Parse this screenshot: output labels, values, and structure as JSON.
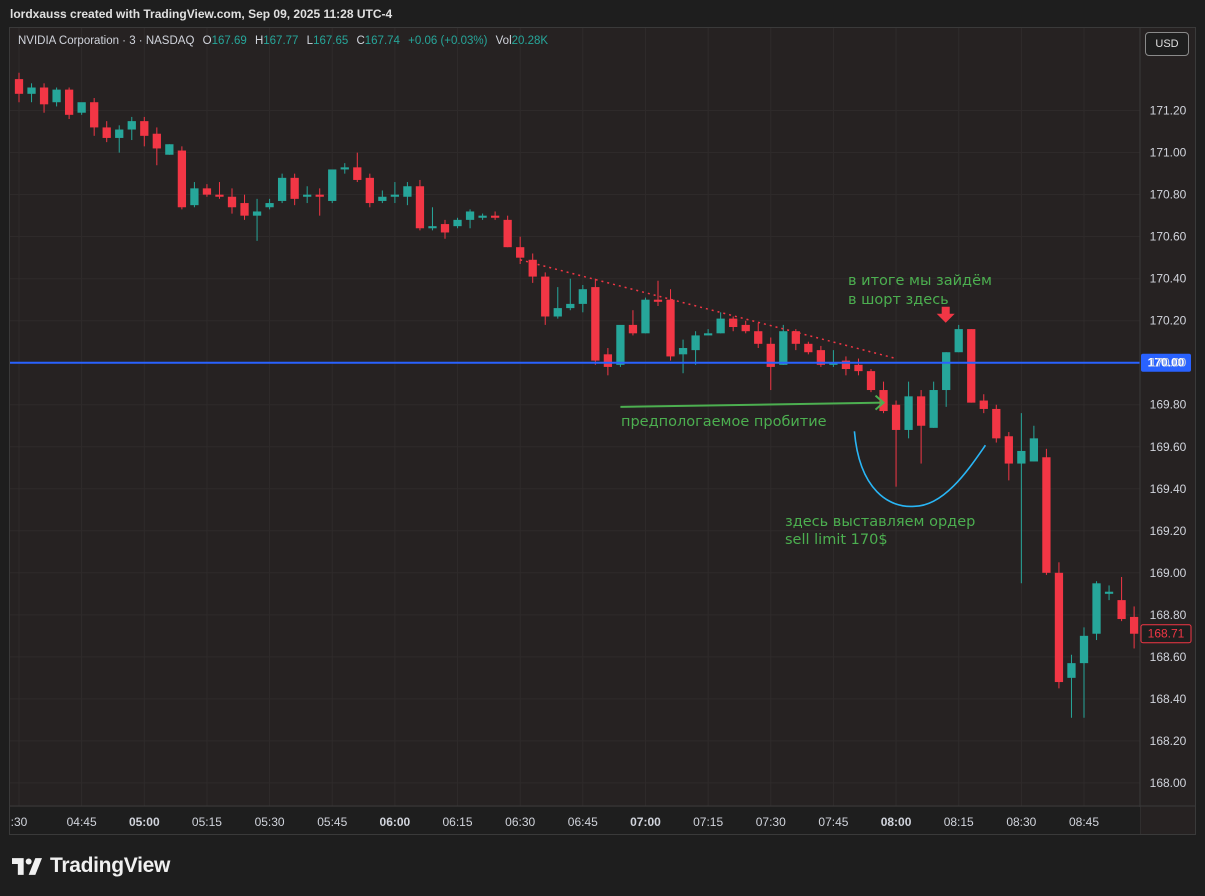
{
  "header": {
    "caption": "lordxauss created with TradingView.com, Sep 09, 2025 11:28 UTC-4"
  },
  "legend": {
    "symbol": "NVIDIA Corporation · 3 · NASDAQ",
    "o_label": "O",
    "o_value": "167.69",
    "h_label": "H",
    "h_value": "167.77",
    "l_label": "L",
    "l_value": "167.65",
    "c_label": "C",
    "c_value": "167.74",
    "change": "+0.06 (+0.03%)",
    "vol_label": "Vol",
    "vol_value": "20.28K"
  },
  "currency_button": "USD",
  "branding": {
    "name": "TradingView"
  },
  "colors": {
    "up": "#26a69a",
    "down": "#f23645",
    "level_line": "#2962ff",
    "annotation": "#4caf50",
    "trendline": "#f23645",
    "curve": "#29b6f6"
  },
  "chart_data": {
    "type": "candlestick",
    "interval": "3 minutes",
    "ylim": [
      167.89,
      171.46
    ],
    "y_ticks": [
      "168.00",
      "168.20",
      "168.40",
      "168.60",
      "168.80",
      "169.00",
      "169.20",
      "169.40",
      "169.60",
      "169.80",
      "170.00",
      "170.20",
      "170.40",
      "170.60",
      "170.80",
      "171.00",
      "171.20"
    ],
    "x_ticks": [
      {
        "t": 0,
        "label": ":30"
      },
      {
        "t": 15,
        "label": "04:45"
      },
      {
        "t": 30,
        "label": "05:00"
      },
      {
        "t": 45,
        "label": "05:15"
      },
      {
        "t": 60,
        "label": "05:30"
      },
      {
        "t": 75,
        "label": "05:45"
      },
      {
        "t": 90,
        "label": "06:00"
      },
      {
        "t": 105,
        "label": "06:15"
      },
      {
        "t": 120,
        "label": "06:30"
      },
      {
        "t": 135,
        "label": "06:45"
      },
      {
        "t": 150,
        "label": "07:00"
      },
      {
        "t": 165,
        "label": "07:15"
      },
      {
        "t": 180,
        "label": "07:30"
      },
      {
        "t": 195,
        "label": "07:45"
      },
      {
        "t": 210,
        "label": "08:00"
      },
      {
        "t": 225,
        "label": "08:15"
      },
      {
        "t": 240,
        "label": "08:30"
      },
      {
        "t": 255,
        "label": "08:45"
      }
    ],
    "candles": [
      {
        "t": 0,
        "o": 171.35,
        "h": 171.38,
        "c": 171.28,
        "l": 171.24
      },
      {
        "t": 3,
        "o": 171.28,
        "h": 171.33,
        "c": 171.31,
        "l": 171.24
      },
      {
        "t": 6,
        "o": 171.31,
        "h": 171.33,
        "c": 171.23,
        "l": 171.19
      },
      {
        "t": 9,
        "o": 171.24,
        "h": 171.31,
        "c": 171.3,
        "l": 171.22
      },
      {
        "t": 12,
        "o": 171.3,
        "h": 171.31,
        "c": 171.18,
        "l": 171.16
      },
      {
        "t": 15,
        "o": 171.19,
        "h": 171.23,
        "c": 171.24,
        "l": 171.18
      },
      {
        "t": 18,
        "o": 171.24,
        "h": 171.26,
        "c": 171.12,
        "l": 171.08
      },
      {
        "t": 21,
        "o": 171.12,
        "h": 171.15,
        "c": 171.07,
        "l": 171.05
      },
      {
        "t": 24,
        "o": 171.07,
        "h": 171.13,
        "c": 171.11,
        "l": 171.0
      },
      {
        "t": 27,
        "o": 171.11,
        "h": 171.17,
        "c": 171.15,
        "l": 171.06
      },
      {
        "t": 30,
        "o": 171.15,
        "h": 171.17,
        "c": 171.08,
        "l": 171.03
      },
      {
        "t": 33,
        "o": 171.09,
        "h": 171.12,
        "c": 171.02,
        "l": 170.94
      },
      {
        "t": 36,
        "o": 170.99,
        "h": 171.04,
        "c": 171.04,
        "l": 170.99
      },
      {
        "t": 39,
        "o": 171.01,
        "h": 171.03,
        "c": 170.74,
        "l": 170.73
      },
      {
        "t": 42,
        "o": 170.75,
        "h": 170.86,
        "c": 170.83,
        "l": 170.74
      },
      {
        "t": 45,
        "o": 170.83,
        "h": 170.85,
        "c": 170.8,
        "l": 170.79
      },
      {
        "t": 48,
        "o": 170.8,
        "h": 170.86,
        "c": 170.79,
        "l": 170.78
      },
      {
        "t": 51,
        "o": 170.79,
        "h": 170.83,
        "c": 170.74,
        "l": 170.71
      },
      {
        "t": 54,
        "o": 170.76,
        "h": 170.8,
        "c": 170.7,
        "l": 170.68
      },
      {
        "t": 57,
        "o": 170.7,
        "h": 170.78,
        "c": 170.72,
        "l": 170.58
      },
      {
        "t": 60,
        "o": 170.74,
        "h": 170.78,
        "c": 170.76,
        "l": 170.73
      },
      {
        "t": 63,
        "o": 170.77,
        "h": 170.9,
        "c": 170.88,
        "l": 170.76
      },
      {
        "t": 66,
        "o": 170.88,
        "h": 170.9,
        "c": 170.78,
        "l": 170.75
      },
      {
        "t": 69,
        "o": 170.79,
        "h": 170.84,
        "c": 170.8,
        "l": 170.76
      },
      {
        "t": 72,
        "o": 170.8,
        "h": 170.83,
        "c": 170.79,
        "l": 170.7
      },
      {
        "t": 75,
        "o": 170.77,
        "h": 170.9,
        "c": 170.92,
        "l": 170.76
      },
      {
        "t": 78,
        "o": 170.92,
        "h": 170.95,
        "c": 170.93,
        "l": 170.9
      },
      {
        "t": 81,
        "o": 170.93,
        "h": 171.0,
        "c": 170.87,
        "l": 170.86
      },
      {
        "t": 84,
        "o": 170.88,
        "h": 170.9,
        "c": 170.76,
        "l": 170.74
      },
      {
        "t": 87,
        "o": 170.77,
        "h": 170.82,
        "c": 170.79,
        "l": 170.76
      },
      {
        "t": 90,
        "o": 170.79,
        "h": 170.86,
        "c": 170.8,
        "l": 170.76
      },
      {
        "t": 93,
        "o": 170.79,
        "h": 170.86,
        "c": 170.84,
        "l": 170.75
      },
      {
        "t": 96,
        "o": 170.84,
        "h": 170.87,
        "c": 170.64,
        "l": 170.63
      },
      {
        "t": 99,
        "o": 170.64,
        "h": 170.74,
        "c": 170.65,
        "l": 170.63
      },
      {
        "t": 102,
        "o": 170.66,
        "h": 170.68,
        "c": 170.62,
        "l": 170.59
      },
      {
        "t": 105,
        "o": 170.65,
        "h": 170.69,
        "c": 170.68,
        "l": 170.64
      },
      {
        "t": 108,
        "o": 170.68,
        "h": 170.73,
        "c": 170.72,
        "l": 170.64
      },
      {
        "t": 111,
        "o": 170.69,
        "h": 170.71,
        "c": 170.7,
        "l": 170.68
      },
      {
        "t": 114,
        "o": 170.7,
        "h": 170.72,
        "c": 170.69,
        "l": 170.68
      },
      {
        "t": 117,
        "o": 170.68,
        "h": 170.7,
        "c": 170.55,
        "l": 170.55
      },
      {
        "t": 120,
        "o": 170.55,
        "h": 170.6,
        "c": 170.5,
        "l": 170.47
      },
      {
        "t": 123,
        "o": 170.49,
        "h": 170.52,
        "c": 170.41,
        "l": 170.38
      },
      {
        "t": 126,
        "o": 170.41,
        "h": 170.43,
        "c": 170.22,
        "l": 170.18
      },
      {
        "t": 129,
        "o": 170.22,
        "h": 170.36,
        "c": 170.26,
        "l": 170.21
      },
      {
        "t": 132,
        "o": 170.26,
        "h": 170.4,
        "c": 170.28,
        "l": 170.25
      },
      {
        "t": 135,
        "o": 170.28,
        "h": 170.37,
        "c": 170.35,
        "l": 170.24
      },
      {
        "t": 138,
        "o": 170.36,
        "h": 170.4,
        "c": 170.01,
        "l": 169.99
      },
      {
        "t": 141,
        "o": 170.04,
        "h": 170.07,
        "c": 169.98,
        "l": 169.94
      },
      {
        "t": 144,
        "o": 169.99,
        "h": 170.16,
        "c": 170.18,
        "l": 169.98
      },
      {
        "t": 147,
        "o": 170.18,
        "h": 170.25,
        "c": 170.14,
        "l": 170.13
      },
      {
        "t": 150,
        "o": 170.14,
        "h": 170.31,
        "c": 170.3,
        "l": 170.14
      },
      {
        "t": 153,
        "o": 170.3,
        "h": 170.39,
        "c": 170.29,
        "l": 170.27
      },
      {
        "t": 156,
        "o": 170.3,
        "h": 170.35,
        "c": 170.03,
        "l": 170.01
      },
      {
        "t": 159,
        "o": 170.04,
        "h": 170.11,
        "c": 170.07,
        "l": 169.95
      },
      {
        "t": 162,
        "o": 170.06,
        "h": 170.15,
        "c": 170.13,
        "l": 169.99
      },
      {
        "t": 165,
        "o": 170.13,
        "h": 170.16,
        "c": 170.14,
        "l": 170.13
      },
      {
        "t": 168,
        "o": 170.14,
        "h": 170.24,
        "c": 170.21,
        "l": 170.14
      },
      {
        "t": 171,
        "o": 170.21,
        "h": 170.22,
        "c": 170.17,
        "l": 170.15
      },
      {
        "t": 174,
        "o": 170.18,
        "h": 170.2,
        "c": 170.15,
        "l": 170.14
      },
      {
        "t": 177,
        "o": 170.15,
        "h": 170.19,
        "c": 170.09,
        "l": 170.07
      },
      {
        "t": 180,
        "o": 170.09,
        "h": 170.12,
        "c": 169.98,
        "l": 169.87
      },
      {
        "t": 183,
        "o": 169.99,
        "h": 170.18,
        "c": 170.15,
        "l": 169.99
      },
      {
        "t": 186,
        "o": 170.15,
        "h": 170.16,
        "c": 170.09,
        "l": 170.06
      },
      {
        "t": 189,
        "o": 170.09,
        "h": 170.1,
        "c": 170.05,
        "l": 170.04
      },
      {
        "t": 192,
        "o": 170.06,
        "h": 170.08,
        "c": 169.99,
        "l": 169.98
      },
      {
        "t": 195,
        "o": 169.99,
        "h": 170.06,
        "c": 170.0,
        "l": 169.98
      },
      {
        "t": 198,
        "o": 170.01,
        "h": 170.03,
        "c": 169.97,
        "l": 169.94
      },
      {
        "t": 201,
        "o": 169.99,
        "h": 170.02,
        "c": 169.96,
        "l": 169.94
      },
      {
        "t": 204,
        "o": 169.96,
        "h": 169.97,
        "c": 169.87,
        "l": 169.86
      },
      {
        "t": 207,
        "o": 169.87,
        "h": 169.91,
        "c": 169.77,
        "l": 169.76
      },
      {
        "t": 210,
        "o": 169.8,
        "h": 169.82,
        "c": 169.68,
        "l": 169.41
      },
      {
        "t": 213,
        "o": 169.68,
        "h": 169.91,
        "c": 169.84,
        "l": 169.64
      },
      {
        "t": 216,
        "o": 169.84,
        "h": 169.87,
        "c": 169.7,
        "l": 169.52
      },
      {
        "t": 219,
        "o": 169.69,
        "h": 169.91,
        "c": 169.87,
        "l": 169.69
      },
      {
        "t": 222,
        "o": 169.87,
        "h": 170.05,
        "c": 170.05,
        "l": 169.79
      },
      {
        "t": 225,
        "o": 170.05,
        "h": 170.18,
        "c": 170.16,
        "l": 170.05
      },
      {
        "t": 228,
        "o": 170.16,
        "h": 170.16,
        "c": 169.81,
        "l": 169.81
      },
      {
        "t": 231,
        "o": 169.82,
        "h": 169.85,
        "c": 169.78,
        "l": 169.76
      },
      {
        "t": 234,
        "o": 169.78,
        "h": 169.8,
        "c": 169.64,
        "l": 169.62
      },
      {
        "t": 237,
        "o": 169.65,
        "h": 169.67,
        "c": 169.52,
        "l": 169.44
      },
      {
        "t": 240,
        "o": 169.52,
        "h": 169.76,
        "c": 169.58,
        "l": 168.95
      },
      {
        "t": 243,
        "o": 169.53,
        "h": 169.7,
        "c": 169.64,
        "l": 169.53
      },
      {
        "t": 246,
        "o": 169.55,
        "h": 169.59,
        "c": 169.0,
        "l": 168.99
      },
      {
        "t": 249,
        "o": 169.0,
        "h": 169.05,
        "c": 168.48,
        "l": 168.45
      },
      {
        "t": 252,
        "o": 168.5,
        "h": 168.61,
        "c": 168.57,
        "l": 168.31
      },
      {
        "t": 255,
        "o": 168.57,
        "h": 168.74,
        "c": 168.7,
        "l": 168.31
      },
      {
        "t": 258,
        "o": 168.71,
        "h": 168.96,
        "c": 168.95,
        "l": 168.68
      },
      {
        "t": 261,
        "o": 168.9,
        "h": 168.94,
        "c": 168.91,
        "l": 168.87
      },
      {
        "t": 264,
        "o": 168.87,
        "h": 168.98,
        "c": 168.78,
        "l": 168.77
      },
      {
        "t": 267,
        "o": 168.79,
        "h": 168.84,
        "c": 168.71,
        "l": 168.64
      }
    ],
    "horizontal_level": {
      "price": 170.0,
      "label": "170.00"
    },
    "last_price": {
      "price": 168.71,
      "label": "168.71"
    },
    "trendline": {
      "from": {
        "t": 120,
        "price": 170.49
      },
      "to": {
        "t": 210,
        "price": 170.02
      }
    },
    "arrow": {
      "from": {
        "t": 144,
        "price": 169.79
      },
      "to": {
        "t": 207,
        "price": 169.81
      }
    },
    "entry_marker": {
      "t": 225,
      "price": 170.2
    },
    "annotations": {
      "entry_line1": "в итоге мы зайдём",
      "entry_line2": "в шорт здесь",
      "breakout": "предпологаемое пробитие",
      "order_line1": "здесь выставляем ордер",
      "order_line2": "sell limit 170$"
    }
  }
}
